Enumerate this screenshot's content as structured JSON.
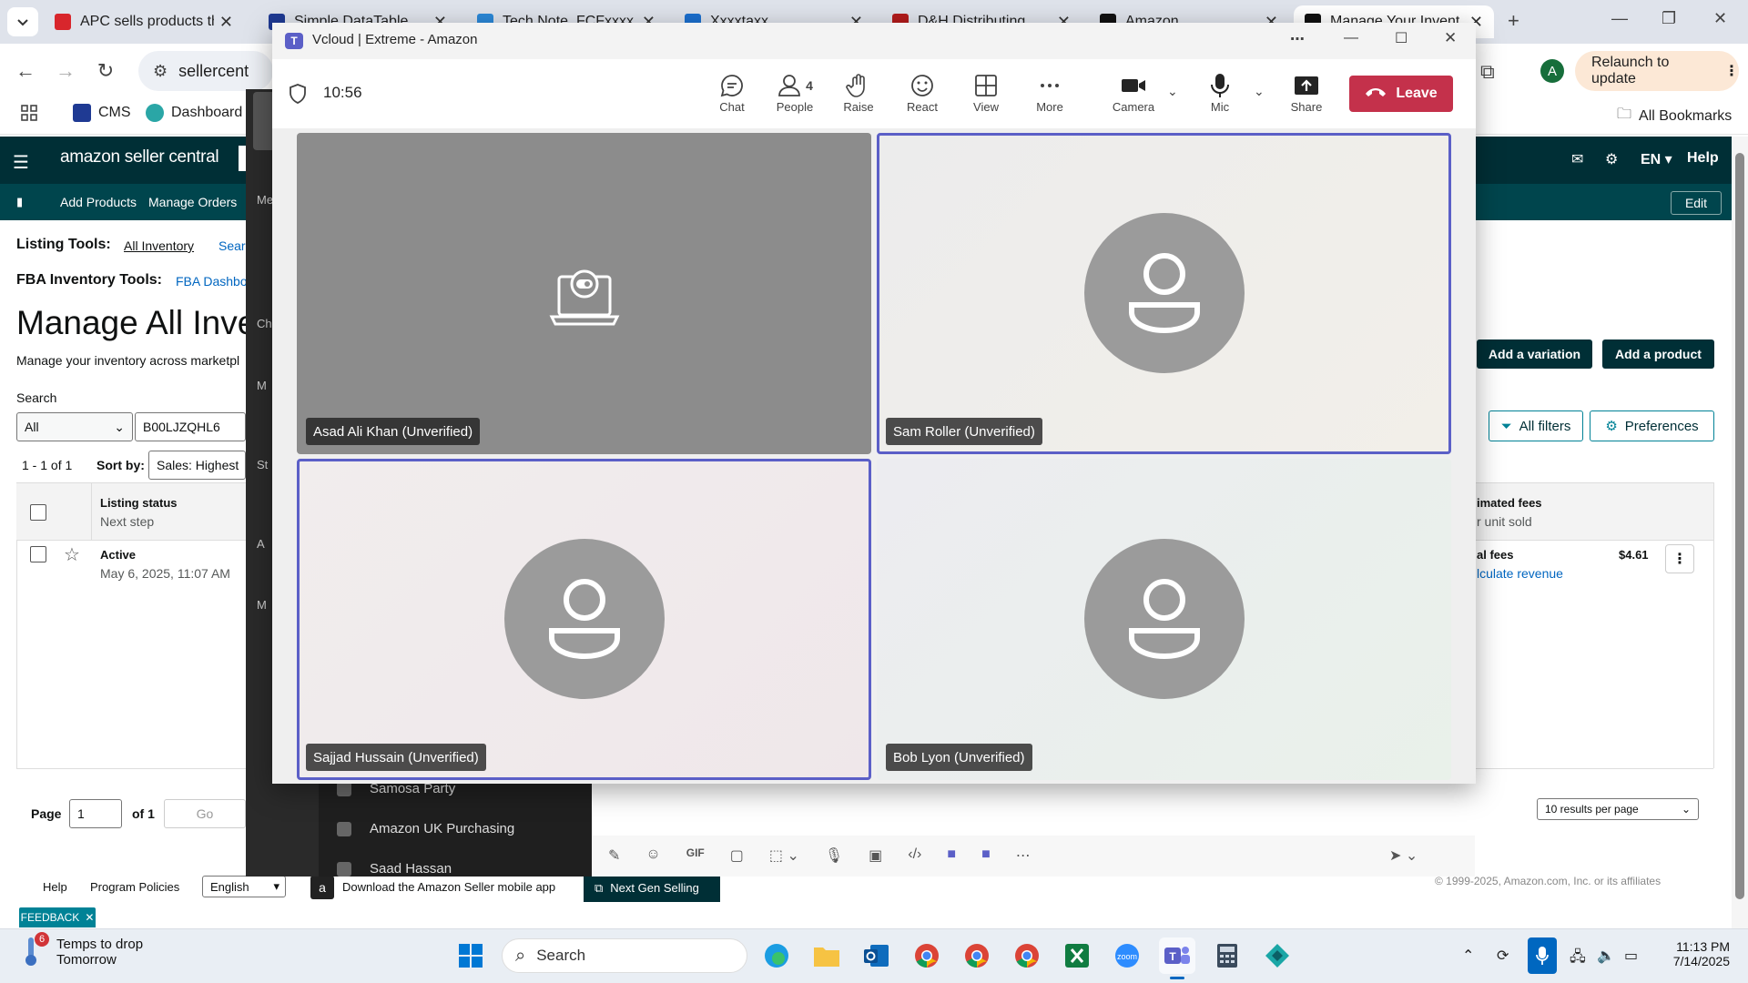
{
  "browser": {
    "tabs": [
      {
        "title": "APC sells products th",
        "fav": "#d8262c"
      },
      {
        "title": "Simple DataTable",
        "fav": "#1f3a93"
      },
      {
        "title": "Tech Note_FCFxxxx",
        "fav": "#2b88d8"
      },
      {
        "title": "Xxxxtaxx",
        "fav": "#1b6fcf"
      },
      {
        "title": "D&H Distributing",
        "fav": "#b31b1b"
      },
      {
        "title": "Amazon",
        "fav": "#111111"
      },
      {
        "title": "Manage Your Invent",
        "fav": "#111111"
      }
    ],
    "address": "sellercent",
    "relaunch": "Relaunch to update",
    "profile_initial": "A",
    "bookmarks": [
      {
        "label": "CMS",
        "color": "#1f3a93"
      },
      {
        "label": "Dashboard",
        "color": "#2aa6a6"
      }
    ],
    "all_bookmarks": "All Bookmarks"
  },
  "amazon": {
    "logo": "amazon seller central",
    "header_right": [
      "EN",
      "Help"
    ],
    "subnav": [
      "Add Products",
      "Manage Orders"
    ],
    "edit": "Edit",
    "listing_tools_label": "Listing Tools:",
    "listing_tools_links": [
      "All Inventory",
      "Sear"
    ],
    "fba_label": "FBA Inventory Tools:",
    "fba_link": "FBA Dashbo",
    "title": "Manage All Inve",
    "subtitle": "Manage your inventory across marketpl",
    "add_variation": "Add a variation",
    "add_product": "Add a product",
    "search_label": "Search",
    "search_scope": "All",
    "search_value": "B00LJZQHL6",
    "all_filters": "All filters",
    "preferences": "Preferences",
    "results_count": "1 - 1 of 1",
    "sort_label": "Sort by:",
    "sort_value": "Sales: Highest",
    "col_status": "Listing status",
    "col_status_sub": "Next step",
    "col_fees": "imated fees",
    "col_fees_sub": "r unit sold",
    "row_status": "Active",
    "row_date": "May 6, 2025, 11:07 AM",
    "row_fees_label": "al fees",
    "row_fees_value": "$4.61",
    "row_calc": "lculate revenue",
    "page_label": "Page",
    "page_value": "1",
    "page_of": "of 1",
    "go": "Go",
    "per_page": "10 results per page",
    "footer_help": "Help",
    "footer_policies": "Program Policies",
    "footer_lang": "English",
    "footer_app": "Download the Amazon Seller mobile app",
    "footer_nextgen": "Next Gen Selling",
    "copyright": "© 1999-2025, Amazon.com, Inc. or its affiliates",
    "feedback": "FEEDBACK"
  },
  "teams_bg": {
    "sidebar_letters": [
      "Me",
      "Ch",
      "M",
      "St",
      "A",
      "M"
    ],
    "chats": [
      "Samosa Party",
      "Amazon UK Purchasing",
      "Saad Hassan"
    ]
  },
  "call": {
    "window_title": "Vcloud | Extreme - Amazon",
    "time": "10:56",
    "controls": [
      {
        "label": "Chat",
        "icon": "chat-icon"
      },
      {
        "label": "People",
        "icon": "people-icon"
      },
      {
        "label": "Raise",
        "icon": "raise-hand-icon"
      },
      {
        "label": "React",
        "icon": "react-icon"
      },
      {
        "label": "View",
        "icon": "view-icon"
      },
      {
        "label": "More",
        "icon": "more-icon"
      }
    ],
    "people_count": "4",
    "camera": "Camera",
    "mic": "Mic",
    "share": "Share",
    "leave": "Leave",
    "participants": [
      {
        "name": "Asad Ali Khan (Unverified)",
        "speaking": false,
        "screen": true
      },
      {
        "name": "Sam Roller (Unverified)",
        "speaking": true,
        "screen": false
      },
      {
        "name": "Sajjad Hussain (Unverified)",
        "speaking": true,
        "screen": false
      },
      {
        "name": "Bob Lyon (Unverified)",
        "speaking": false,
        "screen": false
      }
    ]
  },
  "taskbar": {
    "weather_title": "Temps to drop",
    "weather_sub": "Tomorrow",
    "weather_badge": "6",
    "search": "Search",
    "time": "11:13 PM",
    "date": "7/14/2025"
  }
}
